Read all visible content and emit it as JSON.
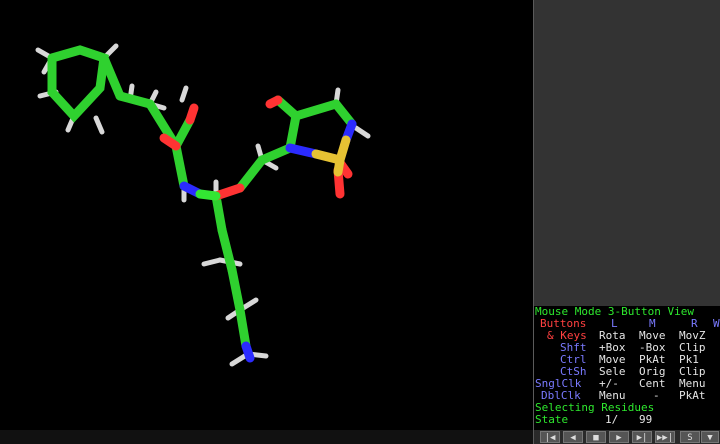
{
  "mouse": {
    "title": "Mouse Mode 3-Button View",
    "row_buttons": {
      "label": "Buttons",
      "l": "L",
      "m": "M",
      "r": "R",
      "w": "W"
    },
    "row_keys": {
      "label": "& Keys",
      "l": "Rota",
      "m": "Move",
      "r": "MovZ"
    },
    "row_shft": {
      "label": "Shft",
      "l": "+Box",
      "m": "-Box",
      "r": "Clip"
    },
    "row_ctrl": {
      "label": "Ctrl",
      "l": "Move",
      "m": "PkAt",
      "r": "Pk1"
    },
    "row_ctsh": {
      "label": "CtSh",
      "l": "Sele",
      "m": "Orig",
      "r": "Clip"
    },
    "row_snglclk": {
      "label": "SnglClk",
      "l": "+/-",
      "m": "Cent",
      "r": "Menu"
    },
    "row_dblclk": {
      "label": "DblClk",
      "l": "Menu",
      "m": "-",
      "r": "PkAt"
    },
    "selecting": "Selecting Residues",
    "state_label": "State",
    "state_value": "1/",
    "state_total": "99"
  },
  "playback": {
    "buttons": [
      "|◀",
      "◀",
      "■",
      "▶",
      "▶|",
      "▶▶|",
      "S",
      "▼"
    ]
  },
  "colors": {
    "carbon": "#33e633",
    "nitrogen": "#2b2bff",
    "oxygen": "#ff3333",
    "sulfur": "#e6c233",
    "hydrogen": "#e6e6e6",
    "background": "#000000"
  }
}
